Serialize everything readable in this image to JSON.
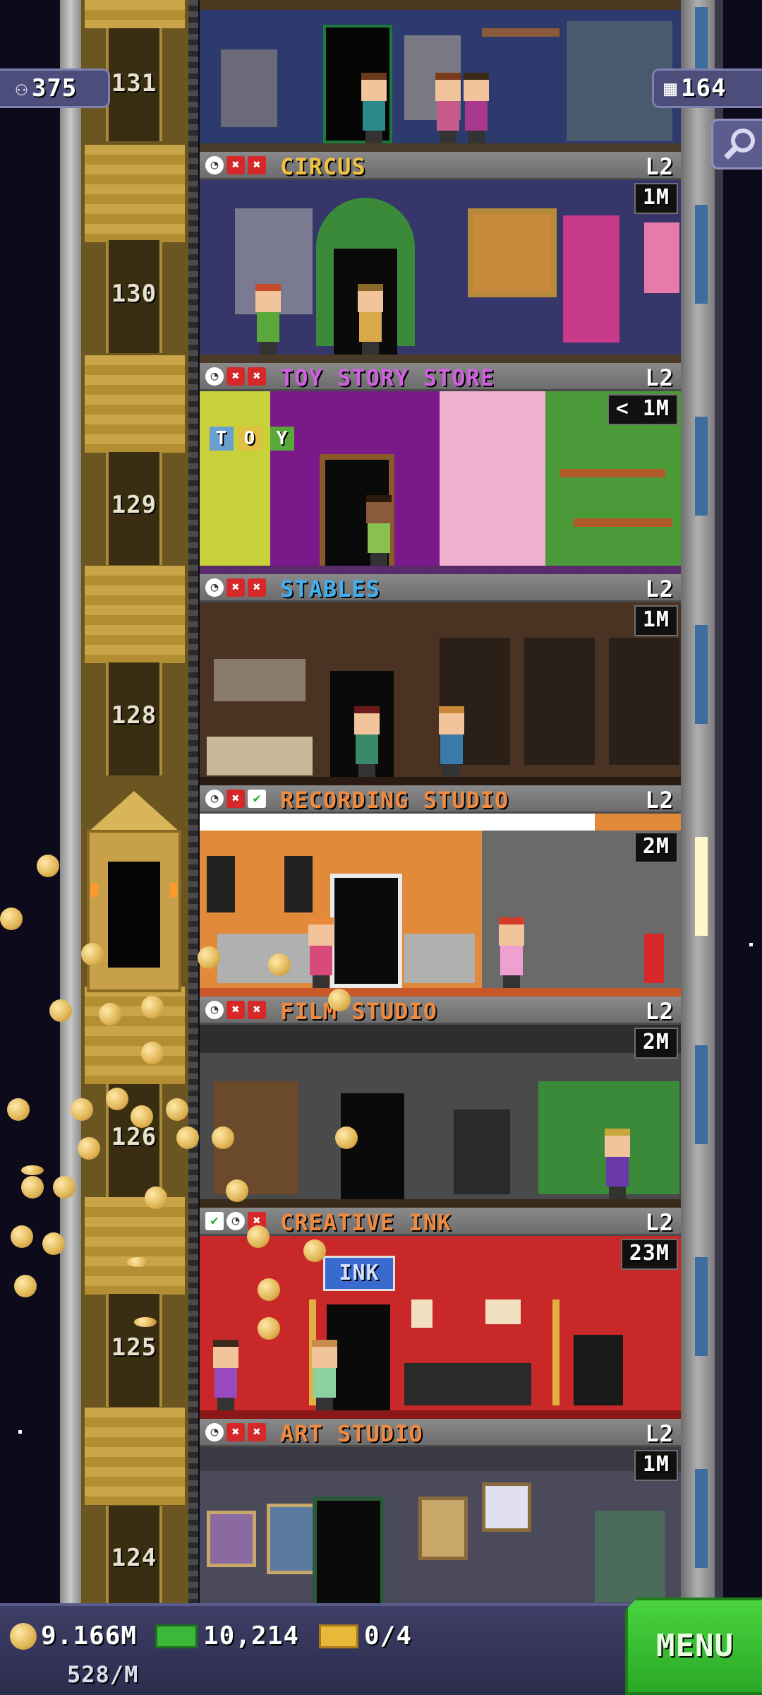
{
  "top_bar": {
    "population": "375",
    "floors": "164",
    "population_icon": "person-icon",
    "floors_icon": "building-icon",
    "search_icon": "magnifier-icon"
  },
  "shaft_floor_numbers": [
    "131",
    "130",
    "129",
    "128",
    "126",
    "125",
    "124"
  ],
  "floors": [
    {
      "name": "CIRCUS",
      "level": "L2",
      "timer": "1M",
      "name_color": "#f0c040",
      "status": [
        "clock",
        "x",
        "x"
      ]
    },
    {
      "name": "TOY STORY STORE",
      "level": "L2",
      "timer": "< 1M",
      "name_color": "#d060e0",
      "status": [
        "clock",
        "x",
        "x"
      ]
    },
    {
      "name": "STABLES",
      "level": "L2",
      "timer": "1M",
      "name_color": "#40b0f0",
      "status": [
        "clock",
        "x",
        "x"
      ]
    },
    {
      "name": "RECORDING STUDIO",
      "level": "L2",
      "timer": "2M",
      "name_color": "#f08a40",
      "status": [
        "clock",
        "x",
        "check"
      ]
    },
    {
      "name": "FILM STUDIO",
      "level": "L2",
      "timer": "2M",
      "name_color": "#f08a40",
      "status": [
        "clock",
        "x",
        "x"
      ]
    },
    {
      "name": "CREATIVE INK",
      "level": "L2",
      "timer": "23M",
      "name_color": "#f08a40",
      "status": [
        "check",
        "clock",
        "x"
      ]
    },
    {
      "name": "ART STUDIO",
      "level": "L2",
      "timer": "1M",
      "name_color": "#f08a40",
      "status": [
        "clock",
        "x",
        "x"
      ]
    }
  ],
  "status_glyphs": {
    "clock": "◔",
    "x": "✖",
    "check": "✔"
  },
  "top_room_sign": "INK",
  "toy_letters": [
    "T",
    "O",
    "Y"
  ],
  "bottom_bar": {
    "coins": "9.166M",
    "coin_rate": "528/M",
    "bux": "10,214",
    "tickets": "0/4",
    "menu_label": "MENU",
    "coin_icon": "coin-icon",
    "bux_icon": "tower-bux-icon",
    "ticket_icon": "golden-ticket-icon"
  },
  "colors": {
    "sky": "#0d0a1c",
    "menu_green": "#2aa826",
    "badge": "#4d4d7c"
  }
}
